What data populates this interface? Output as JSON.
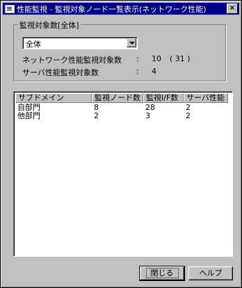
{
  "window": {
    "title": "性能監視 - 監視対象ノード一覧表示(ネットワーク性能)",
    "close_label": "×"
  },
  "group": {
    "legend": "監視対象数[全体]",
    "combo_value": "全体",
    "network_label": "ネットワーク性能監視対象数",
    "network_colon": ":",
    "network_value": "10",
    "network_total": "( 31 )",
    "server_label": "サーバ性能監視対象数",
    "server_colon": ":",
    "server_value": "4"
  },
  "table": {
    "columns": [
      "サブドメイン",
      "監視ノード数",
      "監視I/F数",
      "サーバ性能"
    ],
    "rows": [
      [
        "自部門",
        "8",
        "28",
        "2"
      ],
      [
        "他部門",
        "2",
        "3",
        "2"
      ]
    ]
  },
  "buttons": {
    "close": "閉じる",
    "help": "ヘルプ"
  }
}
